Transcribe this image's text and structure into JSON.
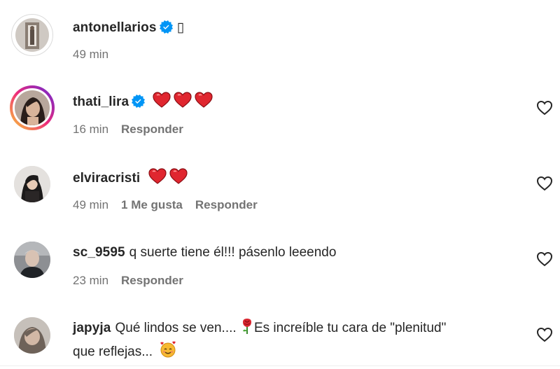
{
  "comments": [
    {
      "username": "antonellarios",
      "verified": true,
      "text": "▯",
      "time": "49 min",
      "likes": "",
      "reply": ""
    },
    {
      "username": "thati_lira",
      "verified": true,
      "text": "",
      "emoji": "❤❤❤",
      "time": "16 min",
      "likes": "",
      "reply": "Responder"
    },
    {
      "username": "elviracristi",
      "verified": false,
      "text": "",
      "emoji": "❤❤",
      "time": "49 min",
      "likes": "1 Me gusta",
      "reply": "Responder"
    },
    {
      "username": "sc_9595",
      "verified": false,
      "text": "q suerte tiene él!!! pásenlo leeendo",
      "time": "23 min",
      "likes": "",
      "reply": "Responder"
    },
    {
      "username": "japyja",
      "verified": false,
      "text": "Qué lindos se ven.... ",
      "text_cont": "Es increíble tu cara de \"plenitud\"",
      "text_line2": "que reflejas... ",
      "emoji_mid": "rose-icon",
      "emoji_end": "smiling-face-with-hearts-icon"
    }
  ],
  "colors": {
    "heart_red": "#e0262f",
    "verified_blue": "#0095f6",
    "meta_gray": "#737373",
    "text": "#262626"
  }
}
